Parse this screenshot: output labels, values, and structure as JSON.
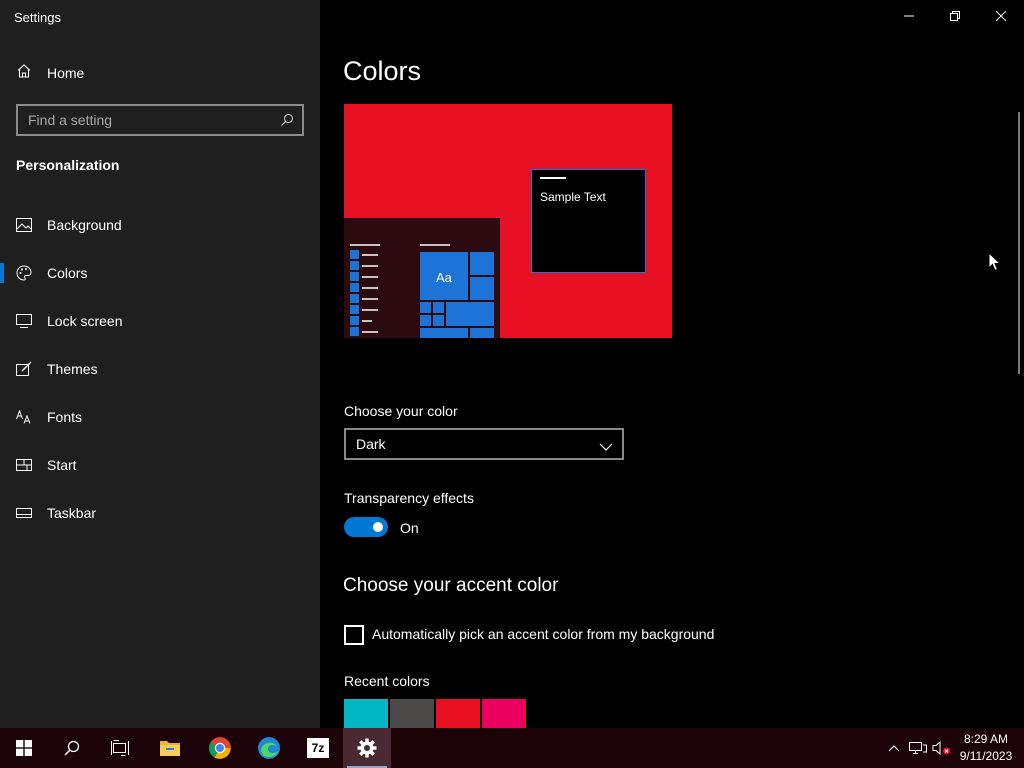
{
  "window": {
    "title": "Settings"
  },
  "sidebar": {
    "home_label": "Home",
    "search_placeholder": "Find a setting",
    "section_title": "Personalization",
    "items": [
      {
        "label": "Background",
        "icon": "picture-icon"
      },
      {
        "label": "Colors",
        "icon": "palette-icon",
        "active": true
      },
      {
        "label": "Lock screen",
        "icon": "lock-screen-icon"
      },
      {
        "label": "Themes",
        "icon": "brush-icon"
      },
      {
        "label": "Fonts",
        "icon": "fonts-icon"
      },
      {
        "label": "Start",
        "icon": "start-icon"
      },
      {
        "label": "Taskbar",
        "icon": "taskbar-icon"
      }
    ]
  },
  "main": {
    "title": "Colors",
    "preview": {
      "sample_text": "Sample Text",
      "tile_text": "Aa",
      "accent": "#e81123"
    },
    "choose_color": {
      "label": "Choose your color",
      "value": "Dark"
    },
    "transparency": {
      "label": "Transparency effects",
      "state_label": "On",
      "on": true
    },
    "accent_heading": "Choose your accent color",
    "auto_accent_label": "Automatically pick an accent color from my background",
    "recent_colors_label": "Recent colors",
    "recent_colors": [
      "#00b7c3",
      "#4c4a48",
      "#e81123",
      "#ea005e"
    ]
  },
  "taskbar": {
    "apps": [
      "start-icon",
      "search-icon",
      "task-view-icon",
      "file-explorer-icon",
      "chrome-icon",
      "edge-icon",
      "7zip-icon",
      "settings-icon"
    ],
    "app_7zip_label": "7z",
    "time": "8:29 AM",
    "date": "9/11/2023"
  },
  "colors": {
    "accent": "#0078d4",
    "sidebar_bg": "#1f1f1f",
    "taskbar_bg": "#1c0308"
  }
}
